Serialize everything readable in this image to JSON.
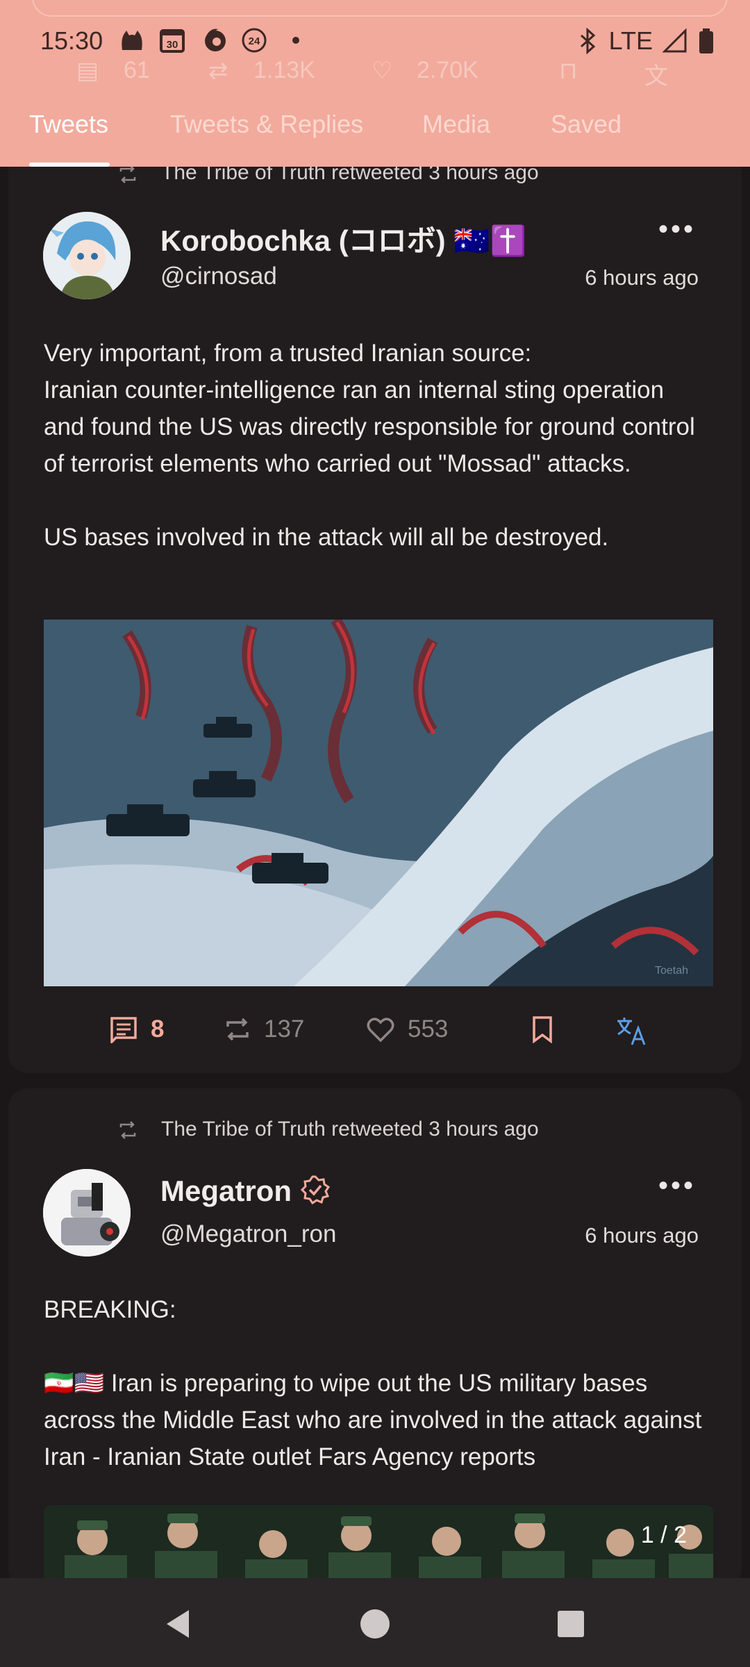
{
  "status_bar": {
    "time": "15:30",
    "notification_icons": [
      "cat-icon",
      "calendar-icon",
      "firefox-icon",
      "news-24-icon",
      "dot-icon"
    ],
    "calendar_day": "30",
    "badge_24": "24",
    "network": "LTE",
    "right_icons": [
      "bluetooth-icon",
      "signal-icon",
      "battery-icon"
    ]
  },
  "ghost_actions": {
    "comments": "61",
    "retweets": "1.13K",
    "likes": "2.70K"
  },
  "tabs": [
    {
      "label": "Tweets",
      "active": true
    },
    {
      "label": "Tweets & Replies",
      "active": false
    },
    {
      "label": "Media",
      "active": false
    },
    {
      "label": "Saved",
      "active": false
    }
  ],
  "tweets": [
    {
      "retweeted_by": "The Tribe of Truth retweeted 3 hours ago",
      "name": "Korobochka (コロボ) 🇦🇺✝️",
      "handle": "@cirnosad",
      "time": "6 hours ago",
      "text": "Very important, from a trusted Iranian source:\nIranian counter-intelligence ran an internal sting operation and found the US was directly responsible for ground control of terrorist elements who carried out \"Mossad\" attacks.\n\nUS bases involved in the attack will all be destroyed.",
      "watermark": "Toetah",
      "comments": "8",
      "retweets": "137",
      "likes": "553"
    },
    {
      "retweeted_by": "The Tribe of Truth retweeted 3 hours ago",
      "name": "Megatron",
      "handle": "@Megatron_ron",
      "time": "6 hours ago",
      "text": "BREAKING:\n\n🇮🇷🇺🇸 Iran is preparing to wipe out the US military bases across the Middle East who are involved in the attack against Iran - Iranian State outlet Fars Agency reports",
      "media_counter": "1 / 2"
    }
  ],
  "colors": {
    "accent": "#f2aa9c",
    "background": "#1b1718",
    "card": "#211c1d",
    "translate": "#5a9fe6"
  }
}
